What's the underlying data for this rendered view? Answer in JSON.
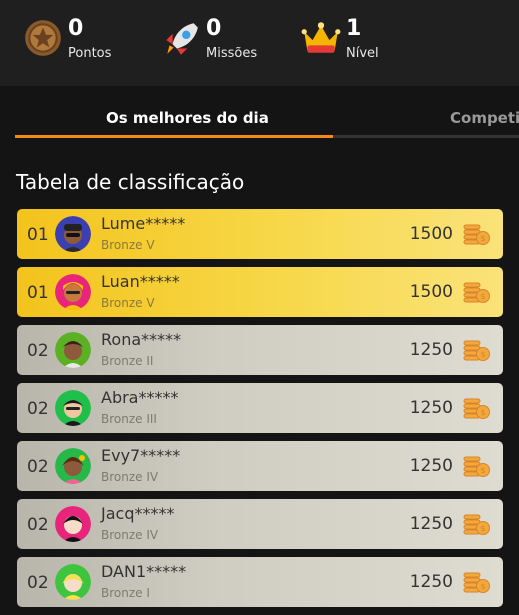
{
  "stats": [
    {
      "value": "0",
      "label": "Pontos",
      "icon": "coin-medal-icon"
    },
    {
      "value": "0",
      "label": "Missões",
      "icon": "rocket-icon"
    },
    {
      "value": "1",
      "label": "Nível",
      "icon": "crown-icon"
    }
  ],
  "tabs": {
    "active": "Os melhores do dia",
    "inactive": "Competiç"
  },
  "section_title": "Tabela de classificação",
  "leaderboard": [
    {
      "rank": "01",
      "name": "Lume*****",
      "level": "Bronze V",
      "score": "1500",
      "style": "gold",
      "avatar_bg": "#3b3fb0"
    },
    {
      "rank": "01",
      "name": "Luan*****",
      "level": "Bronze V",
      "score": "1500",
      "style": "gold",
      "avatar_bg": "#e8257a"
    },
    {
      "rank": "02",
      "name": "Rona*****",
      "level": "Bronze II",
      "score": "1250",
      "style": "silver",
      "avatar_bg": "#5bb024"
    },
    {
      "rank": "02",
      "name": "Abra*****",
      "level": "Bronze III",
      "score": "1250",
      "style": "silver",
      "avatar_bg": "#1fbf4a"
    },
    {
      "rank": "02",
      "name": "Evy7*****",
      "level": "Bronze IV",
      "score": "1250",
      "style": "silver",
      "avatar_bg": "#27b84a"
    },
    {
      "rank": "02",
      "name": "Jacq*****",
      "level": "Bronze IV",
      "score": "1250",
      "style": "silver",
      "avatar_bg": "#e8257a"
    },
    {
      "rank": "02",
      "name": "DAN1*****",
      "level": "Bronze I",
      "score": "1250",
      "style": "silver",
      "avatar_bg": "#3fc43f"
    }
  ],
  "colors": {
    "accent": "#f08b1a",
    "gold_row": "#f5cf2e",
    "silver_row": "#cfcdc2"
  }
}
